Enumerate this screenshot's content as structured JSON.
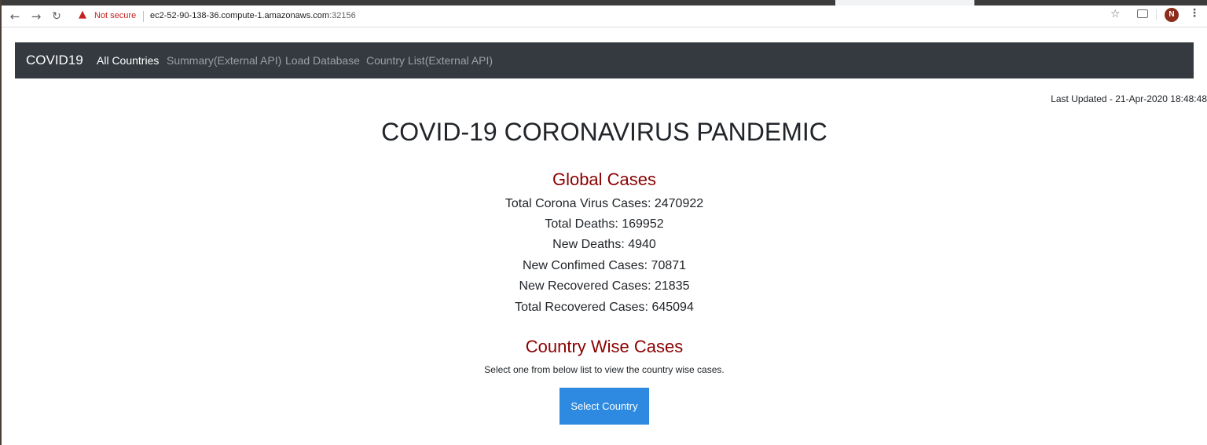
{
  "browser": {
    "security_label": "Not secure",
    "url_host": "ec2-52-90-138-36.compute-1.amazonaws.com",
    "url_port": ":32156",
    "avatar_initial": "N",
    "icons": [
      "back-arrow-icon",
      "forward-arrow-icon",
      "reload-icon",
      "warning-icon",
      "star-icon",
      "cast-icon",
      "menu-icon"
    ]
  },
  "navbar": {
    "brand": "COVID19",
    "links": [
      {
        "label": "All Countries",
        "active": true
      },
      {
        "label": "Summary(External API)",
        "active": false
      },
      {
        "label": "Load Database",
        "active": false
      },
      {
        "label": "Country List(External API)",
        "active": false
      }
    ],
    "background": "#343a40"
  },
  "last_updated": "Last Updated - 21-Apr-2020 18:48:48",
  "page_title": "COVID-19 CORONAVIRUS PANDEMIC",
  "global": {
    "title": "Global Cases",
    "stats": [
      "Total Corona Virus Cases: 2470922",
      "Total Deaths: 169952",
      "New Deaths: 4940",
      "New Confimed Cases: 70871",
      "New Recovered Cases: 21835",
      "Total Recovered Cases: 645094"
    ]
  },
  "country": {
    "title": "Country Wise Cases",
    "helper": "Select one from below list to view the country wise cases.",
    "button_label": "Select Country"
  },
  "colors": {
    "section_title": "#8b0000",
    "button": "#2d8ae0",
    "warning": "#c5221f"
  }
}
